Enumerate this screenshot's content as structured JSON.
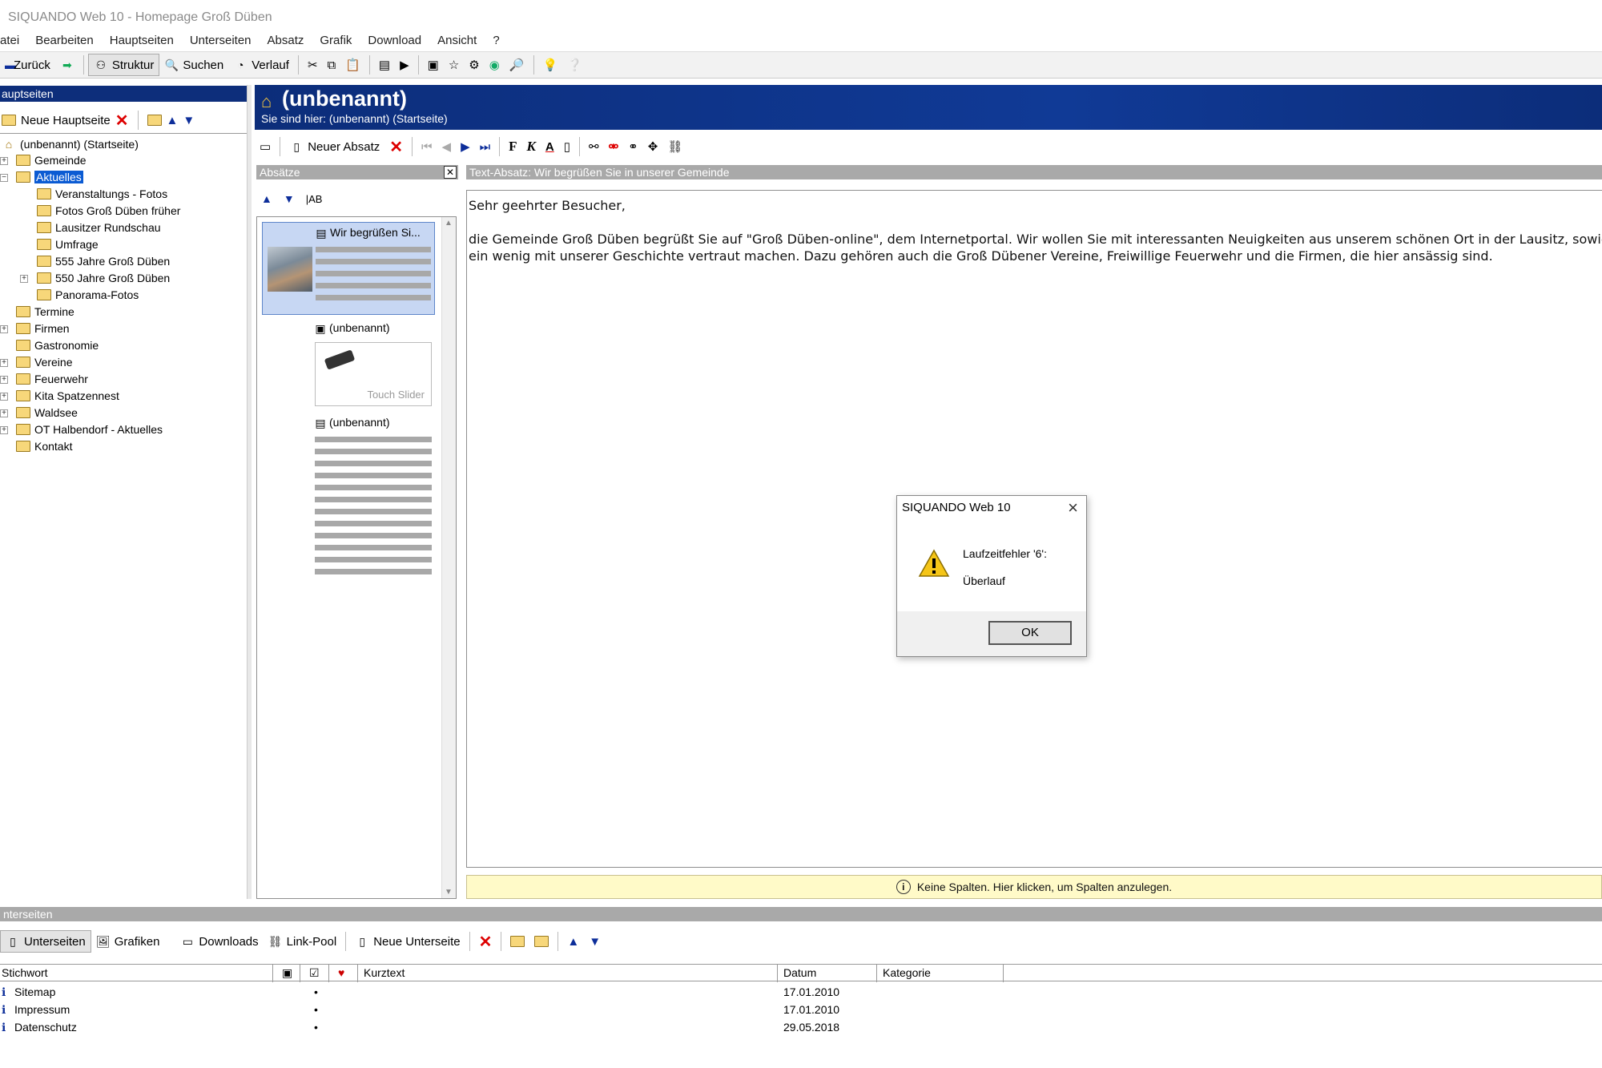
{
  "window": {
    "title": "SIQUANDO Web 10 - Homepage Groß Düben"
  },
  "menu": [
    "atei",
    "Bearbeiten",
    "Hauptseiten",
    "Unterseiten",
    "Absatz",
    "Grafik",
    "Download",
    "Ansicht",
    "?"
  ],
  "toolbar": {
    "back": "Zurück",
    "structure": "Struktur",
    "search": "Suchen",
    "history": "Verlauf"
  },
  "main_pages": {
    "title": "auptseiten",
    "new_button": "Neue Hauptseite",
    "tree": [
      {
        "label": "(unbenannt) (Startseite)"
      },
      {
        "label": "Gemeinde"
      },
      {
        "label": "Aktuelles",
        "selected": true
      },
      {
        "label": "Veranstaltungs - Fotos"
      },
      {
        "label": "Fotos Groß Düben früher"
      },
      {
        "label": "Lausitzer Rundschau"
      },
      {
        "label": "Umfrage"
      },
      {
        "label": "555 Jahre Groß Düben"
      },
      {
        "label": "550 Jahre Groß Düben"
      },
      {
        "label": "Panorama-Fotos"
      },
      {
        "label": "Termine"
      },
      {
        "label": "Firmen"
      },
      {
        "label": "Gastronomie"
      },
      {
        "label": "Vereine"
      },
      {
        "label": "Feuerwehr"
      },
      {
        "label": "Kita Spatzennest"
      },
      {
        "label": "Waldsee"
      },
      {
        "label": "OT Halbendorf - Aktuelles"
      },
      {
        "label": "Kontakt"
      }
    ]
  },
  "page_header": {
    "title": "(unbenannt)",
    "breadcrumb": "Sie sind hier: (unbenannt) (Startseite)"
  },
  "editor_toolbar": {
    "new_paragraph": "Neuer Absatz"
  },
  "paragraphs": {
    "title": "Absätze",
    "items": [
      {
        "label": "Wir begrüßen Si..."
      },
      {
        "label": "(unbenannt)",
        "widget": "Touch Slider"
      },
      {
        "label": "(unbenannt)"
      }
    ]
  },
  "text_paragraph": {
    "title": "Text-Absatz: Wir begrüßen Sie in unserer Gemeinde",
    "greeting": "Sehr geehrter Besucher,",
    "line1": "die Gemeinde Groß Düben begrüßt Sie auf \"Groß Düben-online\", dem Internetportal. Wir wollen Sie mit interessanten Neuigkeiten aus unserem schönen Ort in der Lausitz, sowie",
    "line2": "ein wenig mit unserer Geschichte vertraut machen. Dazu gehören auch die Groß Dübener Vereine, Freiwillige Feuerwehr und die Firmen, die hier ansässig sind."
  },
  "info_bar": {
    "text": "Keine Spalten. Hier klicken, um Spalten anzulegen."
  },
  "dialog": {
    "title": "SIQUANDO Web 10",
    "message1": "Laufzeitfehler '6':",
    "message2": "Überlauf",
    "ok": "OK"
  },
  "subpages": {
    "title": "nterseiten",
    "tabs": {
      "subpages": "Unterseiten",
      "graphics": "Grafiken",
      "downloads": "Downloads",
      "linkpool": "Link-Pool"
    },
    "new_button": "Neue Unterseite",
    "columns": {
      "keyword": "Stichwort",
      "short_text": "Kurztext",
      "date": "Datum",
      "category": "Kategorie"
    },
    "rows": [
      {
        "keyword": "Sitemap",
        "mark": "•",
        "date": "17.01.2010"
      },
      {
        "keyword": "Impressum",
        "mark": "•",
        "date": "17.01.2010"
      },
      {
        "keyword": "Datenschutz",
        "mark": "•",
        "date": "29.05.2018"
      }
    ]
  },
  "colors": {
    "accent": "#0d2e7b",
    "selection": "#0b5bd3",
    "info_bg": "#fffac8"
  }
}
